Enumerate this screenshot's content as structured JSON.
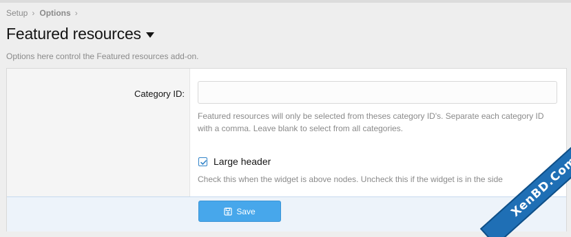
{
  "breadcrumb": {
    "items": [
      "Setup",
      "Options"
    ]
  },
  "page": {
    "title": "Featured resources",
    "description": "Options here control the Featured resources add-on."
  },
  "options": {
    "category_id": {
      "label": "Category ID:",
      "value": "",
      "explain": "Featured resources will only be selected from theses category ID's. Separate each category ID with a comma. Leave blank to select from all categories."
    },
    "large_header": {
      "label": "Large header",
      "checked": true,
      "explain": "Check this when the widget is above nodes. Uncheck this if the widget is in the side"
    }
  },
  "footer": {
    "save_label": "Save"
  },
  "watermark": {
    "text": "XenBD.Com"
  },
  "colors": {
    "accent": "#47a7eb",
    "footer_bg": "#edf3fa",
    "watermark": "#1f6fb5"
  },
  "icons": {
    "title_caret": "caret-down-icon",
    "checkbox": "checkmark-icon",
    "save": "floppy-disk-icon"
  }
}
